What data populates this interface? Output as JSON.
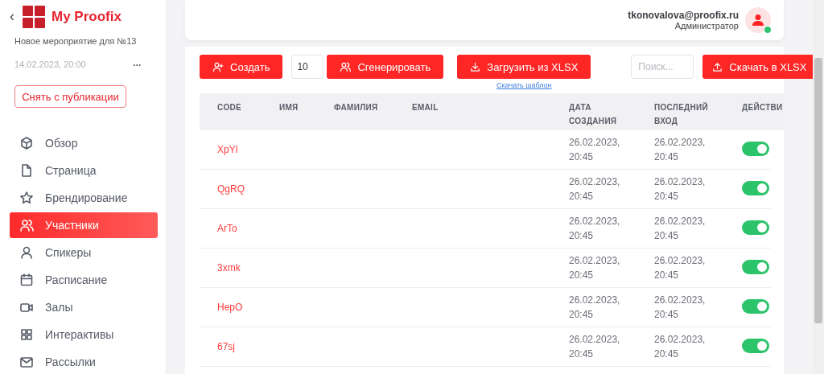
{
  "sidebar": {
    "back": "‹",
    "brand": "My Proofix",
    "event_title": "Новое мероприятие для №13",
    "event_date": "14.02.2023, 20:00",
    "more": "•••",
    "unpublish_button": "Снять с публикации",
    "items": [
      {
        "label": "Обзор",
        "selected": false
      },
      {
        "label": "Страница",
        "selected": false
      },
      {
        "label": "Брендирование",
        "selected": false
      },
      {
        "label": "Участники",
        "selected": true
      },
      {
        "label": "Спикеры",
        "selected": false
      },
      {
        "label": "Расписание",
        "selected": false
      },
      {
        "label": "Залы",
        "selected": false
      },
      {
        "label": "Интерактивы",
        "selected": false
      },
      {
        "label": "Рассылки",
        "selected": false
      }
    ]
  },
  "header": {
    "email": "tkonovalova@proofix.ru",
    "role": "Администратор",
    "online": true
  },
  "toolbar": {
    "create_button": "Создать",
    "count_value": "10",
    "generate_button": "Сгенерировать",
    "upload_button": "Загрузить из XLSX",
    "template_link": "Скачать шаблон",
    "search": {
      "placeholder": "Поиск..."
    },
    "download_button": "Скачать в XLSX"
  },
  "table": {
    "columns": [
      "CODE",
      "ИМЯ",
      "ФАМИЛИЯ",
      "EMAIL",
      "ДАТА СОЗДАНИЯ",
      "ПОСЛЕДНИЙ ВХОД",
      "ДЕЙСТВИ"
    ],
    "rows": [
      {
        "code": "XpYl",
        "created": "26.02.2023, 20:45",
        "last_login": "26.02.2023, 20:45",
        "on": true
      },
      {
        "code": "QgRQ",
        "created": "26.02.2023, 20:45",
        "last_login": "26.02.2023, 20:45",
        "on": true
      },
      {
        "code": "ArTo",
        "created": "26.02.2023, 20:45",
        "last_login": "26.02.2023, 20:45",
        "on": true
      },
      {
        "code": "3xmk",
        "created": "26.02.2023, 20:45",
        "last_login": "26.02.2023, 20:45",
        "on": true
      },
      {
        "code": "HepO",
        "created": "26.02.2023, 20:45",
        "last_login": "26.02.2023, 20:45",
        "on": true
      },
      {
        "code": "67sj",
        "created": "26.02.2023, 20:45",
        "last_login": "26.02.2023, 20:45",
        "on": true
      }
    ]
  }
}
